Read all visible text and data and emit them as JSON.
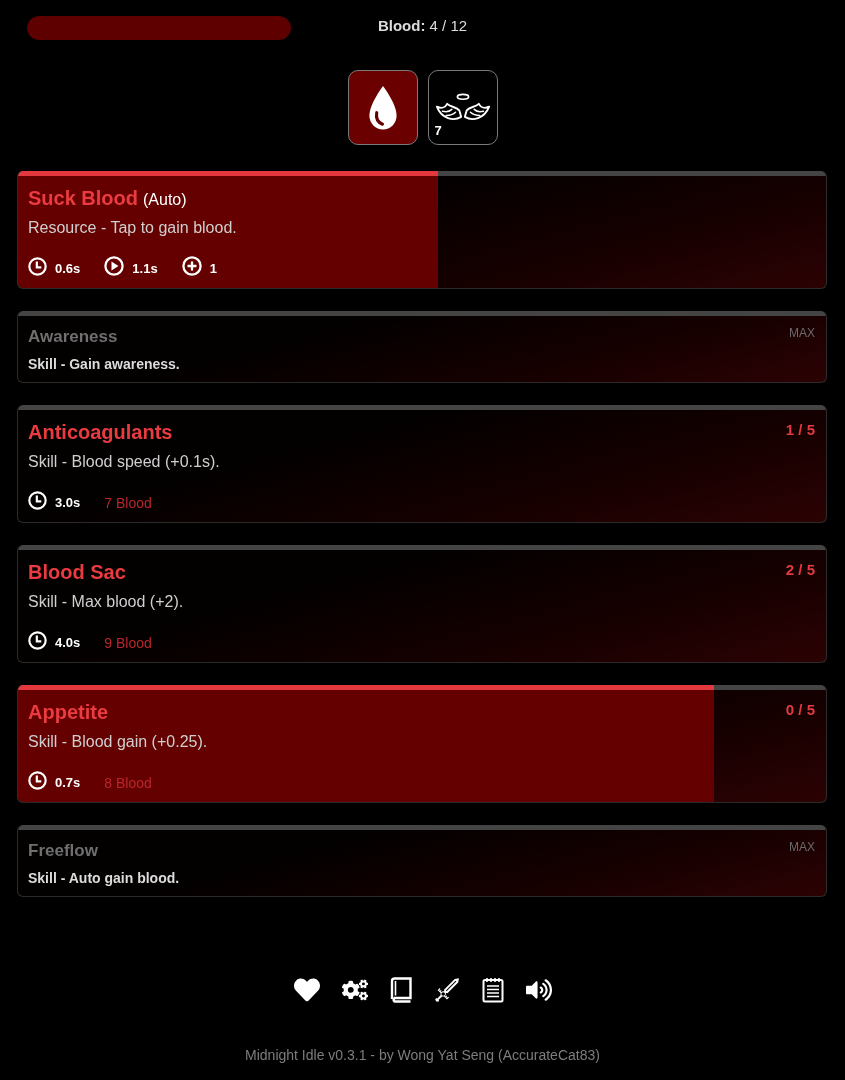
{
  "resource_bar": {
    "label": "**Blood:** 4 / 12",
    "level": 1
  },
  "tabs": [
    {
      "selected": true
    },
    {
      "selected": false,
      "count": "7"
    }
  ],
  "cards": [
    {
      "title": "Suck Blood",
      "tag": "(Auto)",
      "description": "Resource - Tap to gain blood.",
      "maxed": false,
      "level": 0.52,
      "stats": [
        {
          "kind": "timer",
          "value": "0.6s"
        },
        {
          "kind": "play",
          "value": "1.1s"
        },
        {
          "kind": "gain",
          "value": "1"
        }
      ]
    },
    {
      "title": "Awareness",
      "status": "MAX",
      "description": "Skill - Gain awareness.",
      "maxed": true
    },
    {
      "title": "Anticoagulants",
      "status": "1 / 5",
      "description": "Skill - Blood speed (+0.1s).",
      "maxed": false,
      "stats": [
        {
          "kind": "timer",
          "value": "3.0s"
        }
      ],
      "cost": "7 Blood"
    },
    {
      "title": "Blood Sac",
      "status": "2 / 5",
      "description": "Skill - Max blood (+2).",
      "maxed": false,
      "stats": [
        {
          "kind": "timer",
          "value": "4.0s"
        }
      ],
      "cost": "9 Blood"
    },
    {
      "title": "Appetite",
      "status": "0 / 5",
      "description": "Skill - Blood gain (+0.25).",
      "maxed": false,
      "level": 0.862,
      "stats": [
        {
          "kind": "timer",
          "value": "0.7s"
        }
      ],
      "cost": "8 Blood"
    },
    {
      "title": "Freeflow",
      "status": "MAX",
      "description": "Skill - Auto gain blood.",
      "maxed": true
    }
  ],
  "credits": "Midnight Idle v0.3.1 - by Wong Yat Seng (AccurateCat83)"
}
